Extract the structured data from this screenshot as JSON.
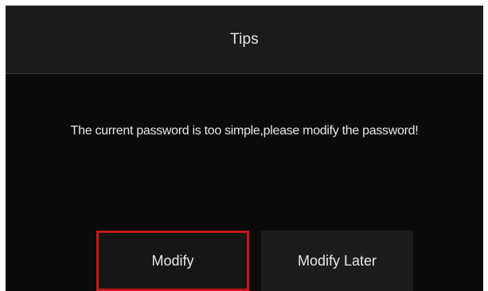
{
  "dialog": {
    "title": "Tips",
    "message": "The current password is too simple,please modify the password!",
    "buttons": {
      "modify_label": "Modify",
      "modify_later_label": "Modify Later"
    }
  },
  "colors": {
    "dialog_background": "#0b0b0b",
    "header_background": "#1b1b1b",
    "focus_border": "#c8171c",
    "text": "#e6e6e6"
  }
}
